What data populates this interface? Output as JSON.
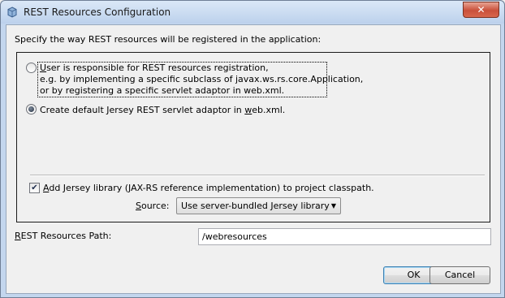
{
  "window": {
    "title": "REST Resources Configuration",
    "close_label": "✕"
  },
  "intro_text": "Specify the way REST resources will be registered in the application:",
  "registration_options": {
    "option_user": {
      "accel": "U",
      "line1_rest": "ser is responsible for REST resources registration,",
      "line2": "e.g. by implementing a specific subclass of javax.ws.rs.core.Application,",
      "line3": "or by registering a specific servlet adaptor in web.xml.",
      "selected": false
    },
    "option_default": {
      "label_before": "Create default Jersey REST servlet adaptor in ",
      "accel": "w",
      "label_after": "eb.xml.",
      "selected": true
    }
  },
  "jersey": {
    "add_library_accel": "A",
    "add_library_rest": "dd Jersey library (JAX-RS reference implementation) to project classpath.",
    "add_library_checked": true,
    "source_accel": "S",
    "source_rest": "ource:",
    "source_value": "Use server-bundled Jersey library"
  },
  "path": {
    "label_accel": "R",
    "label_rest": "EST Resources Path:",
    "value": "/webresources"
  },
  "buttons": {
    "ok": "OK",
    "cancel": "Cancel"
  },
  "colors": {
    "title_bar": "#c3d6ee",
    "close_button": "#c9503a",
    "default_button_border": "#3c7fb1"
  }
}
